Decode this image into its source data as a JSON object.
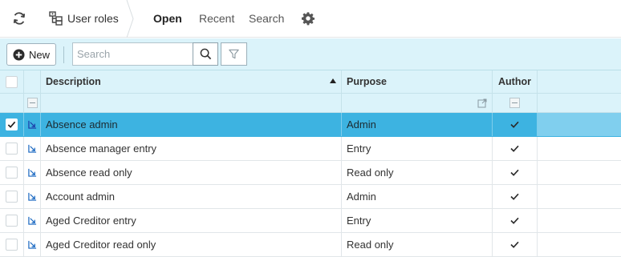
{
  "nav": {
    "module_label": "User roles",
    "tabs": [
      {
        "label": "Open",
        "active": true
      },
      {
        "label": "Recent",
        "active": false
      },
      {
        "label": "Search",
        "active": false
      }
    ],
    "icons": [
      "refresh-icon",
      "user-roles-icon",
      "settings-gear-icon"
    ]
  },
  "toolbar": {
    "new_label": "New",
    "search_placeholder": "Search",
    "search_value": ""
  },
  "grid": {
    "columns": {
      "description": "Description",
      "purpose": "Purpose",
      "author": "Author"
    },
    "sort": {
      "column": "description",
      "direction": "ascending"
    },
    "rows": [
      {
        "description": "Absence admin",
        "purpose": "Admin",
        "author": true,
        "selected": true
      },
      {
        "description": "Absence manager entry",
        "purpose": "Entry",
        "author": true,
        "selected": false
      },
      {
        "description": "Absence read only",
        "purpose": "Read only",
        "author": true,
        "selected": false
      },
      {
        "description": "Account admin",
        "purpose": "Admin",
        "author": true,
        "selected": false
      },
      {
        "description": "Aged Creditor entry",
        "purpose": "Entry",
        "author": true,
        "selected": false
      },
      {
        "description": "Aged Creditor read only",
        "purpose": "Read only",
        "author": true,
        "selected": false
      }
    ]
  },
  "colors": {
    "accent": "#3db3e1",
    "toolbar_bg": "#dbf3fa",
    "link_icon": "#1565c0"
  }
}
